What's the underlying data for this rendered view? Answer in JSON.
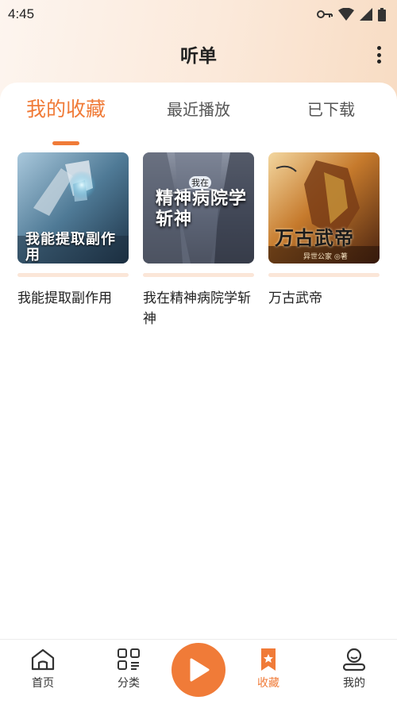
{
  "status_bar": {
    "time": "4:45"
  },
  "header": {
    "title": "听单"
  },
  "tabs": [
    {
      "label": "我的收藏",
      "active": true
    },
    {
      "label": "最近播放",
      "active": false
    },
    {
      "label": "已下载",
      "active": false
    }
  ],
  "books": [
    {
      "title": "我能提取副作用",
      "cover_text": "我能提取副作用"
    },
    {
      "title": "我在精神病院学斩神",
      "cover_text": "精神病院学斩神",
      "cover_badge": "我在"
    },
    {
      "title": "万古武帝",
      "cover_text": "万古武帝",
      "cover_author": "异世公家 ◎著"
    }
  ],
  "bottom_nav": [
    {
      "label": "首页",
      "icon": "home-icon"
    },
    {
      "label": "分类",
      "icon": "category-icon"
    },
    {
      "label": "",
      "icon": "play-icon"
    },
    {
      "label": "收藏",
      "icon": "bookmark-icon",
      "active": true
    },
    {
      "label": "我的",
      "icon": "user-icon"
    }
  ],
  "colors": {
    "accent": "#f07b38",
    "tab_inactive": "#555555",
    "text": "#222222"
  }
}
